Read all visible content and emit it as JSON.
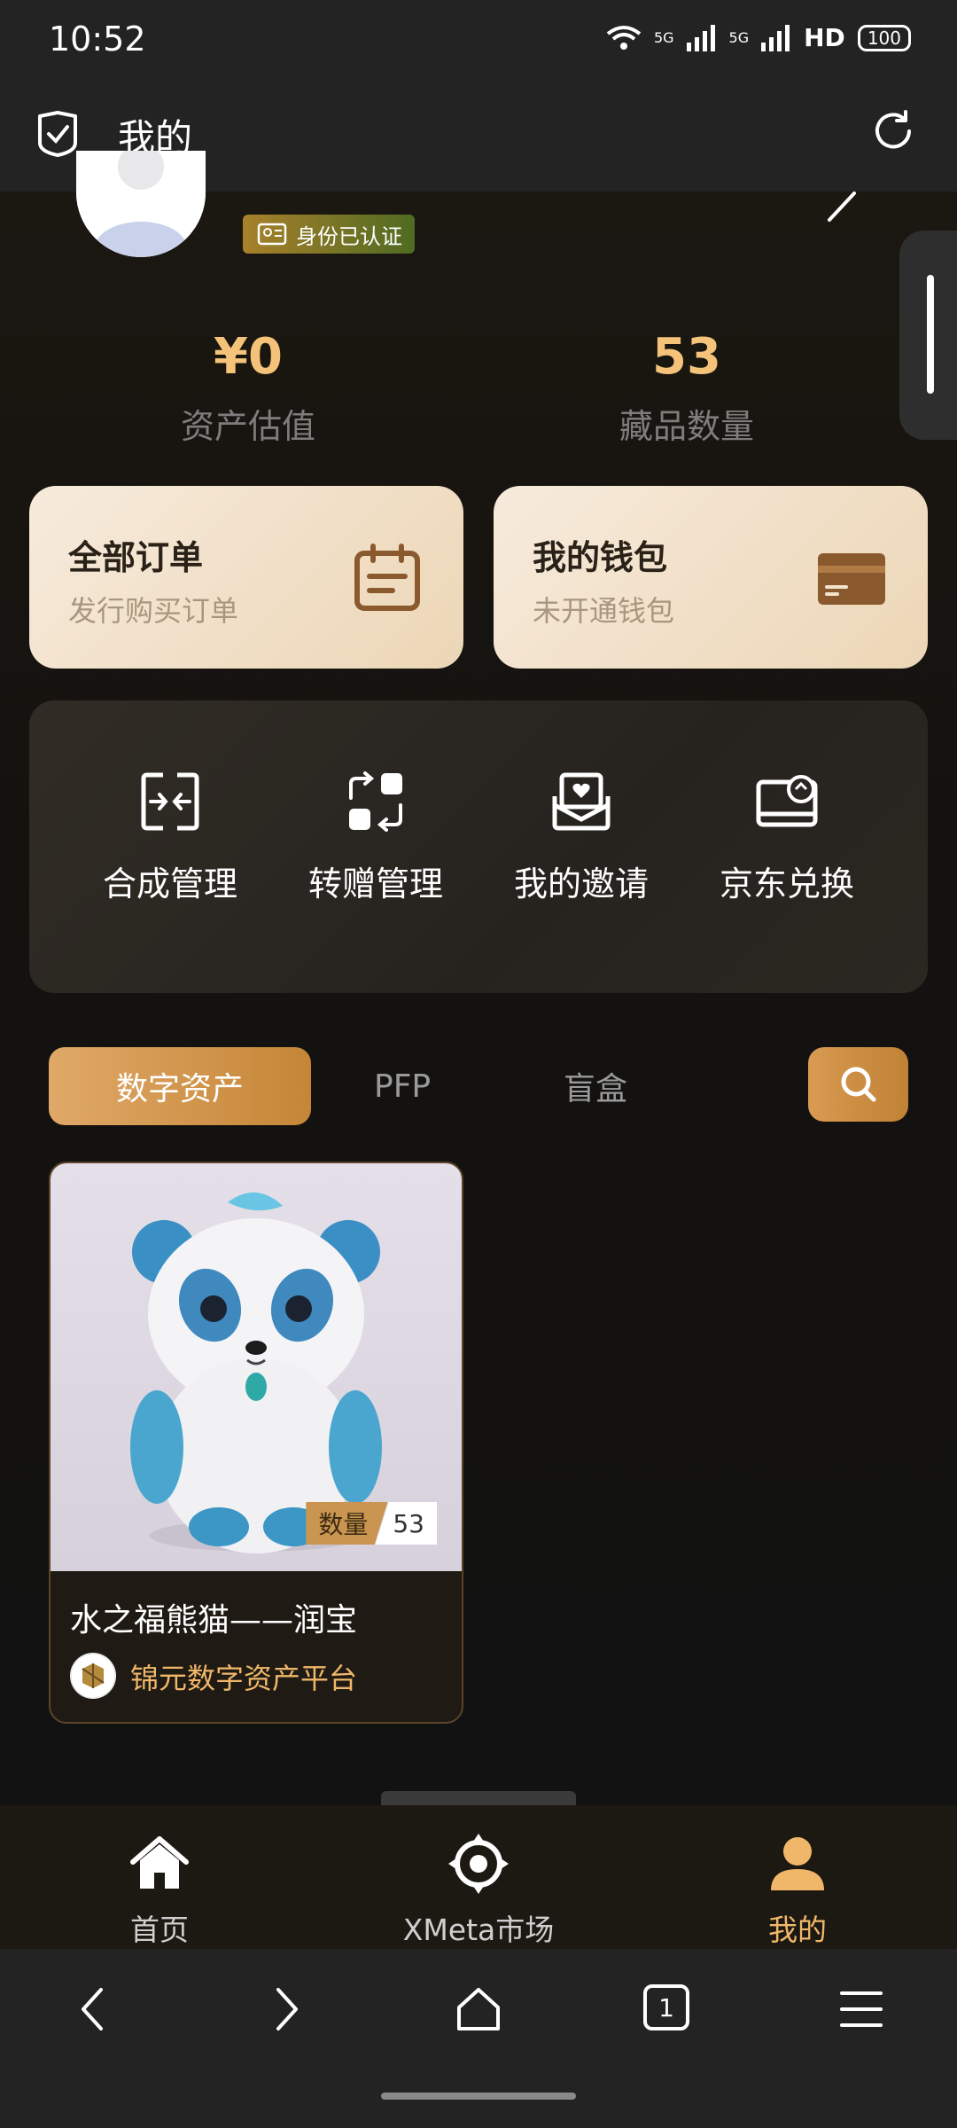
{
  "status_bar": {
    "time": "10:52",
    "network": "5G",
    "network2": "5G",
    "hd": "HD",
    "battery": "100"
  },
  "header": {
    "title": "我的"
  },
  "profile": {
    "badge_text": "身份已认证"
  },
  "stats": {
    "asset_value": "¥0",
    "asset_label": "资产估值",
    "collection_count": "53",
    "collection_label": "藏品数量"
  },
  "cards": {
    "orders": {
      "title": "全部订单",
      "subtitle": "发行购买订单"
    },
    "wallet": {
      "title": "我的钱包",
      "subtitle": "未开通钱包"
    }
  },
  "tools": [
    {
      "label": "合成管理",
      "icon": "merge-icon"
    },
    {
      "label": "转赠管理",
      "icon": "transfer-icon"
    },
    {
      "label": "我的邀请",
      "icon": "invite-mail-icon"
    },
    {
      "label": "京东兑换",
      "icon": "redeem-card-icon"
    }
  ],
  "tabs": {
    "active": "数字资产",
    "pfp": "PFP",
    "blindbox": "盲盒"
  },
  "items": [
    {
      "name": "水之福熊猫——润宝",
      "issuer": "锦元数字资产平台",
      "qty_label": "数量",
      "qty_value": "53"
    }
  ],
  "bottom_nav": [
    {
      "label": "首页",
      "icon": "home-icon",
      "active": false
    },
    {
      "label": "XMeta市场",
      "icon": "market-icon",
      "active": false
    },
    {
      "label": "我的",
      "icon": "profile-icon",
      "active": true
    }
  ],
  "browser_bar": {
    "tab_count": "1"
  },
  "colors": {
    "accent_gold": "#f5c279",
    "button_gold": "#c58636",
    "card_cream": "#f3e3cc",
    "background": "#121212"
  }
}
